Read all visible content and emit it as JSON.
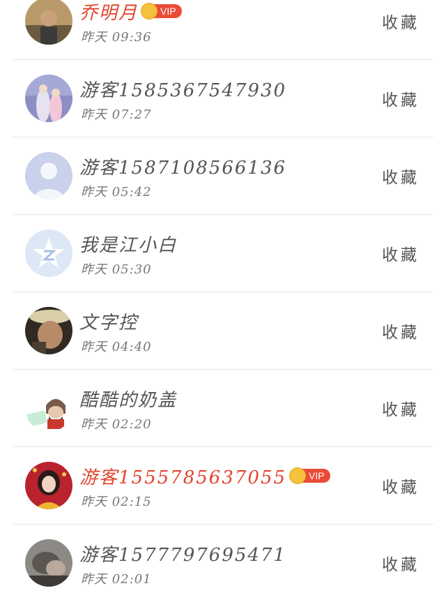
{
  "list": {
    "action_label": "收藏",
    "vip_label": "VIP",
    "items": [
      {
        "name": "乔明月",
        "time": "昨天 09:36",
        "vip": true,
        "avatar": "photo-avatar"
      },
      {
        "name": "游客1585367547930",
        "time": "昨天 07:27",
        "vip": false,
        "avatar": "photo-avatar"
      },
      {
        "name": "游客1587108566136",
        "time": "昨天 05:42",
        "vip": false,
        "avatar": "default-person-avatar"
      },
      {
        "name": "我是江小白",
        "time": "昨天 05:30",
        "vip": false,
        "avatar": "qzone-star-avatar"
      },
      {
        "name": "文字控",
        "time": "昨天 04:40",
        "vip": false,
        "avatar": "photo-avatar"
      },
      {
        "name": "酷酷的奶盖",
        "time": "昨天 02:20",
        "vip": false,
        "avatar": "cartoon-avatar"
      },
      {
        "name": "游客1555785637055",
        "time": "昨天 02:15",
        "vip": true,
        "avatar": "photo-avatar"
      },
      {
        "name": "游客1577797695471",
        "time": "昨天 02:01",
        "vip": false,
        "avatar": "photo-avatar"
      }
    ]
  },
  "colors": {
    "vip_name": "#e2452f",
    "vip_tag": "#ea4b37",
    "crown": "#f6c13d",
    "text": "#555555",
    "divider": "#e6e6e6"
  }
}
